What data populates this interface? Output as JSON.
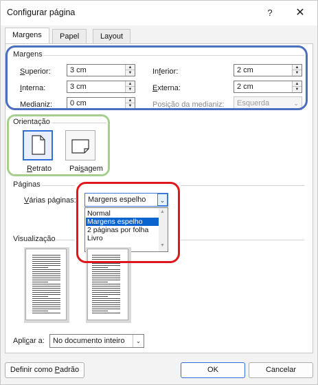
{
  "window": {
    "title": "Configurar página",
    "help_label": "?",
    "close_label": "✕"
  },
  "tabs": [
    {
      "label": "Margens",
      "active": true
    },
    {
      "label": "Papel",
      "active": false
    },
    {
      "label": "Layout",
      "active": false
    }
  ],
  "margins": {
    "group_title": "Margens",
    "superior": {
      "label_pre": "",
      "label_u": "S",
      "label_post": "uperior:",
      "value": "3 cm"
    },
    "inferior": {
      "label_pre": "In",
      "label_u": "f",
      "label_post": "erior:",
      "value": "2 cm"
    },
    "interna": {
      "label_pre": "",
      "label_u": "I",
      "label_post": "nterna:",
      "value": "3 cm"
    },
    "externa": {
      "label_pre": "",
      "label_u": "E",
      "label_post": "xterna:",
      "value": "2 cm"
    },
    "medianiz": {
      "label_pre": "Medianiz:",
      "value": "0 cm"
    },
    "posicao_medianiz": {
      "label": "Posição da medianiz:",
      "value": "Esquerda"
    }
  },
  "orientation": {
    "group_title": "Orientação",
    "retrato": {
      "label_u": "R",
      "label_post": "etrato",
      "icon": "portrait-page-icon"
    },
    "paisagem": {
      "label_pre": "Pai",
      "label_u": "s",
      "label_post": "agem",
      "icon": "landscape-page-icon"
    }
  },
  "pages": {
    "group_title": "Páginas",
    "multiple_label_u": "V",
    "multiple_label_post": "árias páginas:",
    "selected": "Margens espelho",
    "options": [
      "Normal",
      "Margens espelho",
      "2 páginas por folha",
      "Livro"
    ]
  },
  "preview": {
    "group_title": "Visualização"
  },
  "apply": {
    "label_pre": "Apli",
    "label_u": "c",
    "label_post": "ar a:",
    "value": "No documento inteiro"
  },
  "footer": {
    "default_pre": "Definir como ",
    "default_u": "P",
    "default_post": "adrão",
    "ok_label": "OK",
    "cancel_label": "Cancelar"
  },
  "colors": {
    "annotation_blue": "#4a6fbf",
    "annotation_green": "#a6cf8f",
    "annotation_red": "#e0161c",
    "selection": "#0a64d0"
  }
}
